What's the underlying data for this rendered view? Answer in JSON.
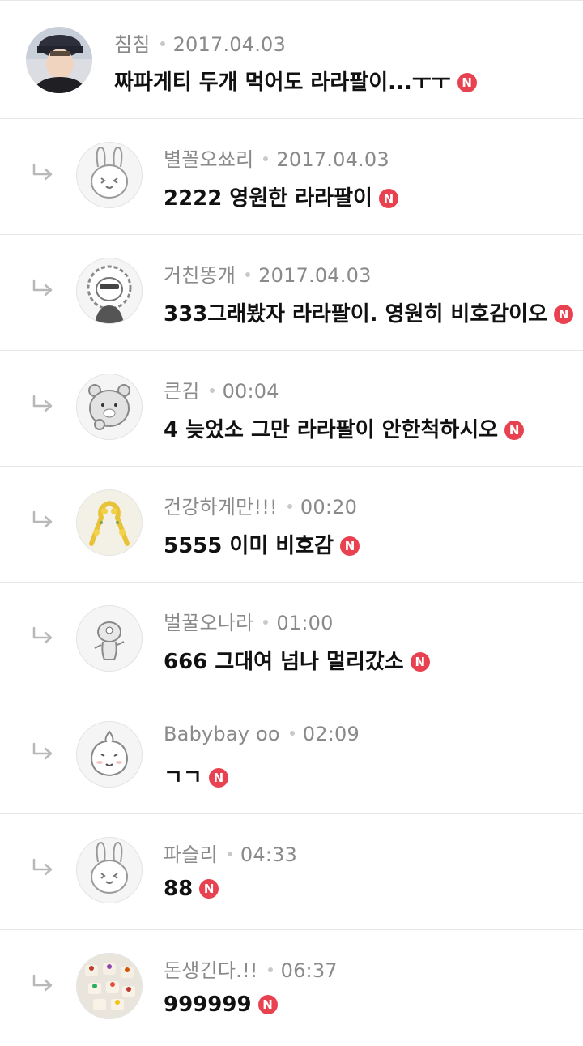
{
  "new_badge": "N",
  "comments": [
    {
      "author": "침침",
      "time": "2017.04.03",
      "text": "짜파게티 두개 먹어도 라라팔이...ㅜㅜ",
      "avatar": "photo-avatar",
      "is_reply": false
    },
    {
      "author": "별꼴오쑈리",
      "time": "2017.04.03",
      "text": "2222 영원한 라라팔이",
      "avatar": "rabbit-avatar",
      "is_reply": true
    },
    {
      "author": "거친똥개",
      "time": "2017.04.03",
      "text": "333그래봤자 라라팔이. 영원히 비호감이오",
      "avatar": "lion-avatar",
      "is_reply": true
    },
    {
      "author": "큰김",
      "time": "00:04",
      "text": "4 늦었소 그만 라라팔이 안한척하시오",
      "avatar": "bear-avatar",
      "is_reply": true
    },
    {
      "author": "건강하게만!!!",
      "time": "00:20",
      "text": "5555 이미 비호감",
      "avatar": "flower-ribbon-avatar",
      "is_reply": true
    },
    {
      "author": "벌꿀오나라",
      "time": "01:00",
      "text": "666 그대여 넘나 멀리갔소",
      "avatar": "alien-avatar",
      "is_reply": true
    },
    {
      "author": "Babybay oo",
      "time": "02:09",
      "text": "ㄱㄱ",
      "avatar": "peach-avatar",
      "is_reply": true
    },
    {
      "author": "파슬리",
      "time": "04:33",
      "text": "88",
      "avatar": "rabbit-avatar",
      "is_reply": true
    },
    {
      "author": "돈생긴다.!!",
      "time": "06:37",
      "text": "999999",
      "avatar": "cake-avatar",
      "is_reply": true
    }
  ]
}
